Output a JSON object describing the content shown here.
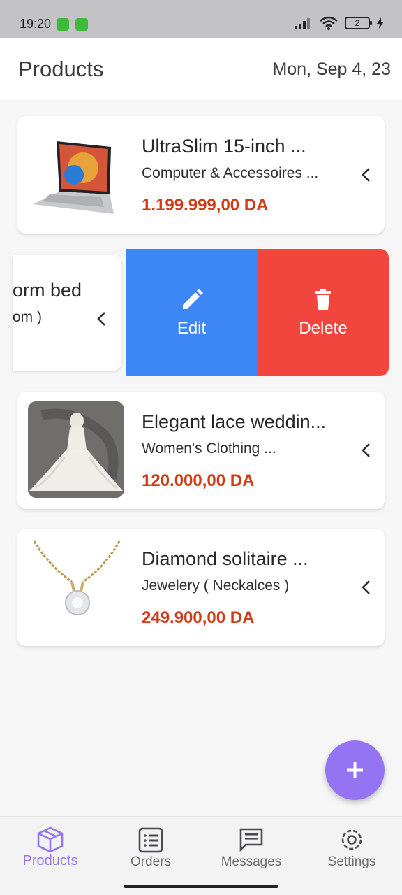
{
  "status": {
    "time": "19:20",
    "battery": "2"
  },
  "header": {
    "title": "Products",
    "date": "Mon, Sep 4, 23"
  },
  "products": [
    {
      "name": "UltraSlim 15-inch ...",
      "category": "Computer & Accessoires ...",
      "price": "1.199.999,00 DA"
    },
    {
      "name": "orm bed",
      "category": "om )"
    },
    {
      "name": "Elegant lace weddin...",
      "category": "Women's Clothing ...",
      "price": "120.000,00 DA"
    },
    {
      "name": "Diamond solitaire ...",
      "category": "Jewelery ( Neckalces )",
      "price": "249.900,00 DA"
    }
  ],
  "actions": {
    "edit": "Edit",
    "delete": "Delete"
  },
  "nav": {
    "products": "Products",
    "orders": "Orders",
    "messages": "Messages",
    "settings": "Settings"
  },
  "colors": {
    "accent": "#9474f2",
    "edit": "#3d86f5",
    "delete": "#f2453d",
    "price": "#d23a14"
  }
}
